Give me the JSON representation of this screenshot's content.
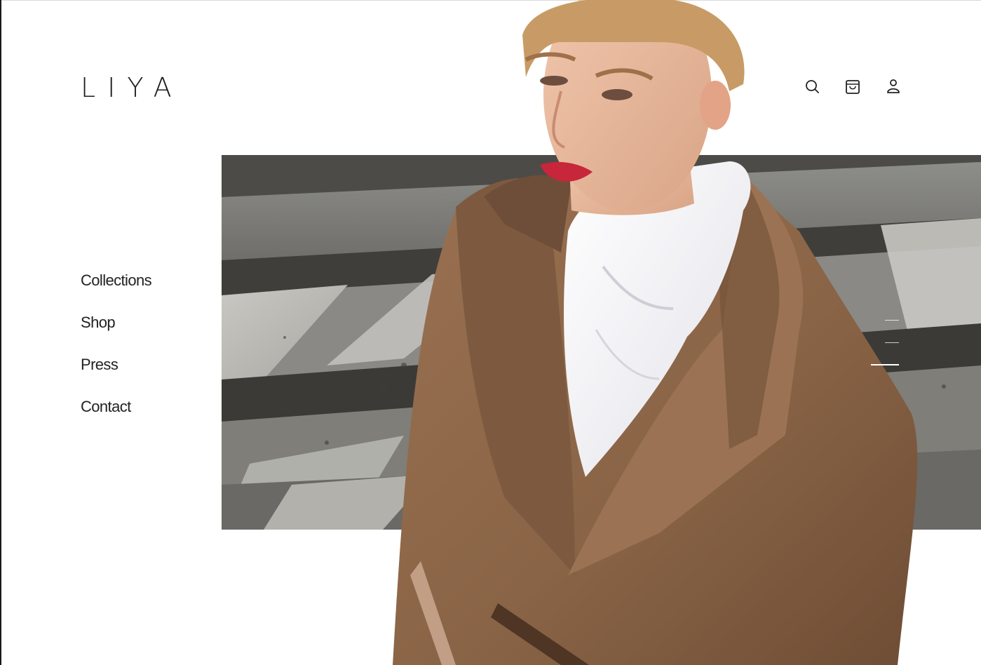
{
  "brand": {
    "logo_text": "LIYA"
  },
  "nav": {
    "items": [
      "Collections",
      "Shop",
      "Press",
      "Contact"
    ]
  },
  "header": {
    "icons": [
      "search-icon",
      "shopping-bag-icon",
      "user-icon"
    ]
  },
  "hero": {
    "image_description": "Model in camel trench coat with white high-neck scarf against stone steps",
    "slides_total": 3,
    "slide_active": 3
  },
  "colors": {
    "text": "#222222",
    "coat": "#8a6446",
    "coat_shadow": "#5b3e2a",
    "scarf": "#f4f3f7",
    "skin": "#e7b79a",
    "hair": "#c89b66",
    "steps_light": "#a9a9a6",
    "steps_dark": "#4a4843"
  }
}
